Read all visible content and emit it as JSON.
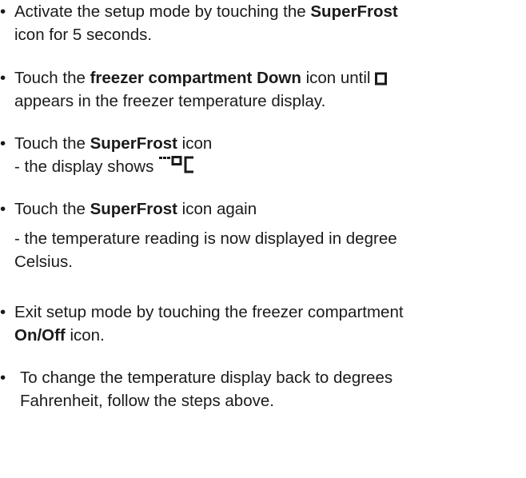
{
  "bullet": "•",
  "items": [
    {
      "l1a": "Activate the setup mode by touching the ",
      "l1b": "SuperFrost",
      "l2": "icon for 5 seconds."
    },
    {
      "l1a": "Touch the ",
      "l1b": "freezer compartment Down",
      "l1c": " icon until ",
      "l2": "appears in the freezer temperature display."
    },
    {
      "l1a": "Touch the ",
      "l1b": "SuperFrost",
      "l1c": " icon",
      "l2": "- the display shows "
    },
    {
      "l1a": "Touch the ",
      "l1b": "SuperFrost",
      "l1c": " icon again",
      "l2": "- the temperature reading is now displayed in degree",
      "l3": "Celsius."
    },
    {
      "l1": "Exit setup mode by touching the freezer compartment",
      "l2a": "On/Off",
      "l2b": " icon."
    },
    {
      "l1": "To change the temperature display back to degrees",
      "l2": "Fahrenheit, follow the steps above."
    }
  ],
  "icons": {
    "segment_box": "seven-segment-box-icon",
    "menu_oc": "menu-degree-celsius-icon"
  }
}
